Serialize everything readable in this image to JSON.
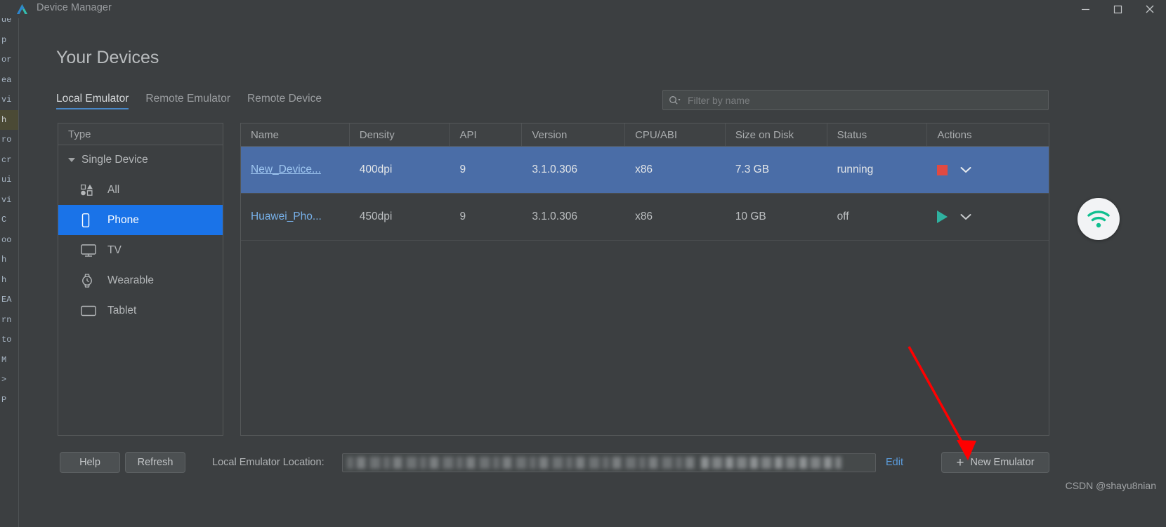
{
  "window": {
    "title": "Device Manager",
    "logo_icon": "android-studio-logo-icon",
    "minimize_icon": "minimize-icon",
    "maximize_icon": "maximize-icon",
    "close_icon": "close-icon"
  },
  "page": {
    "heading": "Your Devices"
  },
  "tabs": [
    {
      "label": "Local Emulator",
      "active": true
    },
    {
      "label": "Remote Emulator",
      "active": false
    },
    {
      "label": "Remote Device",
      "active": false
    }
  ],
  "search": {
    "placeholder": "Filter by name",
    "value": "",
    "icon": "search-icon"
  },
  "sidebar": {
    "header": "Type",
    "group": "Single Device",
    "items": [
      {
        "label": "All",
        "icon": "all-devices-icon",
        "selected": false
      },
      {
        "label": "Phone",
        "icon": "phone-icon",
        "selected": true
      },
      {
        "label": "TV",
        "icon": "tv-icon",
        "selected": false
      },
      {
        "label": "Wearable",
        "icon": "watch-icon",
        "selected": false
      },
      {
        "label": "Tablet",
        "icon": "tablet-icon",
        "selected": false
      }
    ]
  },
  "table": {
    "columns": [
      "Name",
      "Density",
      "API",
      "Version",
      "CPU/ABI",
      "Size on Disk",
      "Status",
      "Actions"
    ],
    "rows": [
      {
        "name": "New_Device...",
        "density": "400dpi",
        "api": "9",
        "version": "3.1.0.306",
        "cpu_abi": "x86",
        "size_on_disk": "7.3 GB",
        "status": "running",
        "action_icon": "stop-icon",
        "menu_icon": "chevron-down-icon",
        "selected": true
      },
      {
        "name": "Huawei_Pho...",
        "density": "450dpi",
        "api": "9",
        "version": "3.1.0.306",
        "cpu_abi": "x86",
        "size_on_disk": "10 GB",
        "status": "off",
        "action_icon": "play-icon",
        "menu_icon": "chevron-down-icon",
        "selected": false
      }
    ]
  },
  "footer": {
    "help_label": "Help",
    "refresh_label": "Refresh",
    "location_label": "Local Emulator Location:",
    "location_value": "",
    "edit_label": "Edit",
    "new_emulator_label": "New Emulator",
    "new_emulator_icon": "plus-icon"
  },
  "annotations": {
    "watermark": "CSDN @shayu8nian",
    "arrow_color": "#ff0000",
    "badge_icon": "wifi-icon"
  },
  "edge_strip": [
    "de",
    "p",
    "or",
    "ea",
    "vi",
    "h",
    "ro",
    "cr",
    "ui",
    "vi",
    "C",
    "oo",
    "h",
    "h",
    "EA",
    "rn",
    "to",
    "M",
    ">",
    "P"
  ],
  "colors": {
    "background": "#3c3f41",
    "accent_blue": "#1a73e8",
    "selection_blue": "#4a6da7",
    "link_blue": "#5b9cdc",
    "stop_red": "#e04a42",
    "play_green": "#2fb2a0"
  }
}
